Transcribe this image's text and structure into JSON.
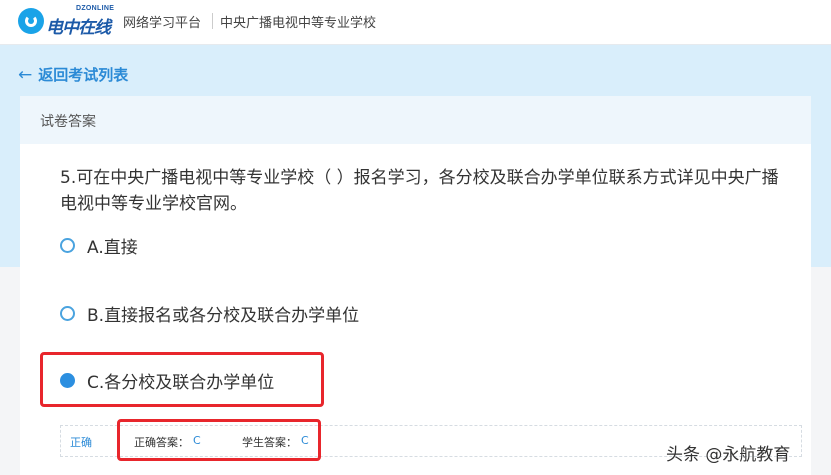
{
  "header": {
    "logo_tag": "DZONLINE",
    "logo_text": "电中在线",
    "platform": "网络学习平台",
    "school": "中央广播电视中等专业学校"
  },
  "nav": {
    "back_label": "返回考试列表"
  },
  "card": {
    "title": "试卷答案"
  },
  "question": {
    "text": "5.可在中央广播电视中等专业学校（ ）报名学习，各分校及联合办学单位联系方式详见中央广播电视中等专业学校官网。",
    "options": [
      {
        "label": "A.直接",
        "selected": false
      },
      {
        "label": "B.直接报名或各分校及联合办学单位",
        "selected": false
      },
      {
        "label": "C.各分校及联合办学单位",
        "selected": true
      }
    ]
  },
  "result": {
    "status": "正确",
    "correct_answer_label": "正确答案：",
    "correct_answer_value": "C",
    "student_answer_label": "学生答案：",
    "student_answer_value": "C"
  },
  "watermark": "头条 @永航教育",
  "colors": {
    "accent": "#2b8ad6",
    "highlight_border": "#e8262c",
    "band": "#d9eefb"
  }
}
